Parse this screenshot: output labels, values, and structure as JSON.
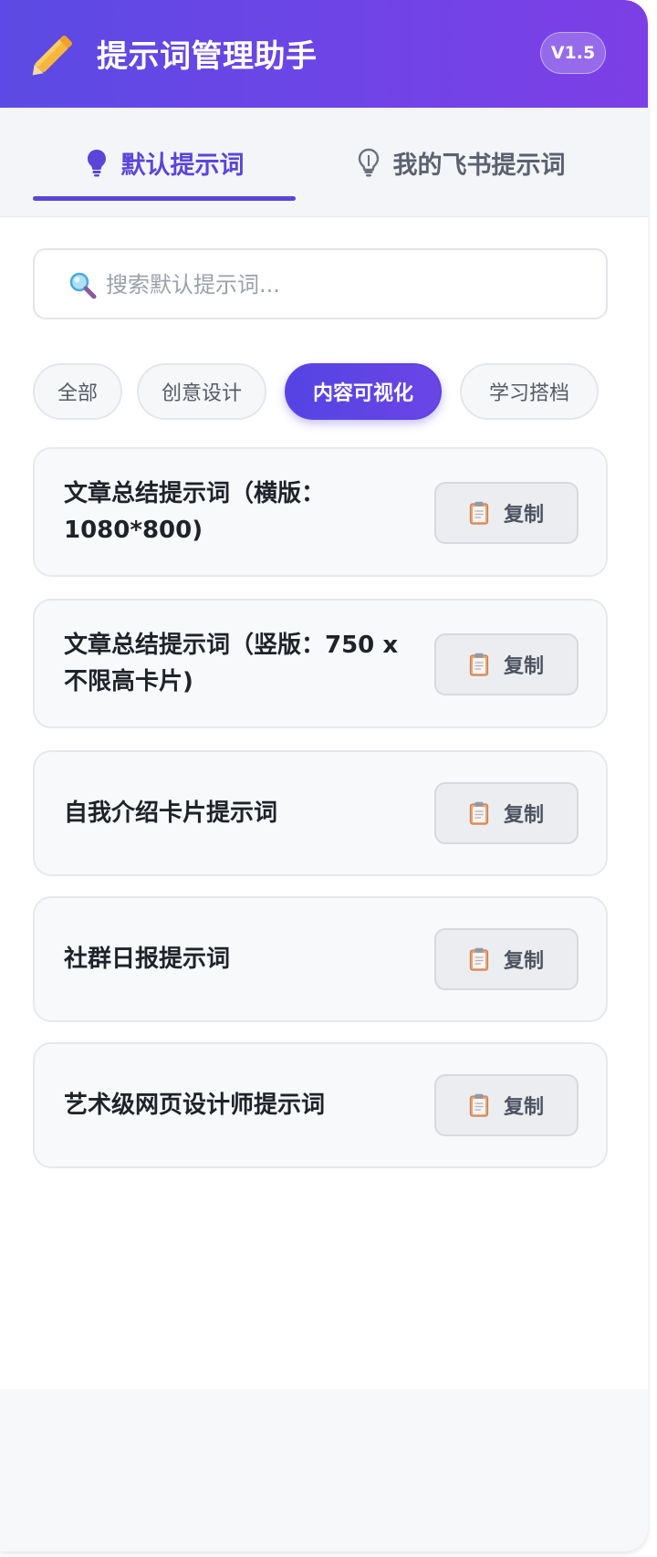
{
  "header": {
    "title": "提示词管理助手",
    "version": "V1.5",
    "logo_icon": "pencil-icon"
  },
  "tabs": [
    {
      "label": "默认提示词",
      "icon": "lightbulb-icon",
      "active": true
    },
    {
      "label": "我的飞书提示词",
      "icon": "lightbulb-icon",
      "active": false
    }
  ],
  "search": {
    "placeholder": "搜索默认提示词...",
    "value": "",
    "icon": "search-icon"
  },
  "categories": [
    {
      "label": "全部",
      "active": false
    },
    {
      "label": "创意设计",
      "active": false
    },
    {
      "label": "内容可视化",
      "active": true
    },
    {
      "label": "学习搭档",
      "active": false
    }
  ],
  "prompts": [
    {
      "title": "文章总结提示词（横版：1080*800)",
      "copy_label": "复制"
    },
    {
      "title": "文章总结提示词（竖版：750 x 不限高卡片)",
      "copy_label": "复制"
    },
    {
      "title": "自我介绍卡片提示词",
      "copy_label": "复制"
    },
    {
      "title": "社群日报提示词",
      "copy_label": "复制"
    },
    {
      "title": "艺术级网页设计师提示词",
      "copy_label": "复制"
    }
  ],
  "colors": {
    "accent": "#5b45d9",
    "header_start": "#5b4ae3",
    "header_end": "#7c3fe6"
  }
}
